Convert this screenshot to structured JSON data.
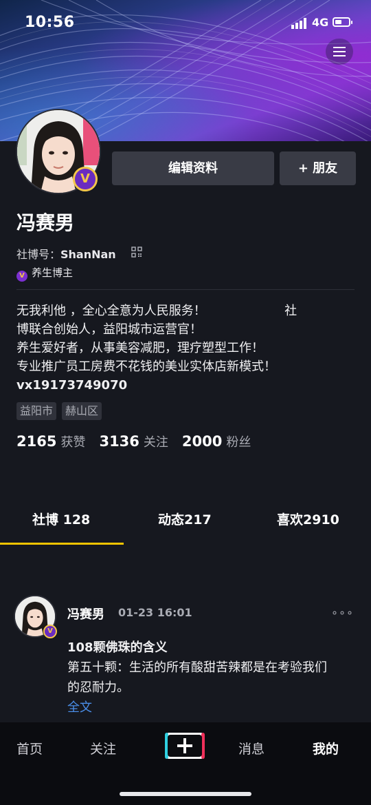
{
  "status_bar": {
    "time": "10:56",
    "network": "4G"
  },
  "profile": {
    "name": "冯赛男",
    "id_label": "社博号：",
    "id_value": "ShanNan",
    "verified_tag": "养生博主",
    "edit_button": "编辑资料",
    "add_friend_button": "+ 朋友"
  },
  "bio": {
    "lines": [
      "无我利他 ，全心全意为人民服务！                    社",
      "博联合创始人，益阳城市运营官！",
      "养生爱好者，从事美容减肥，理疗塑型工作！",
      "专业推广员工房费不花钱的美业实体店新模式！",
      "vx19173749070"
    ]
  },
  "locations": [
    "益阳市",
    "赫山区"
  ],
  "stats": [
    {
      "value": "2165",
      "label": "获赞"
    },
    {
      "value": "3136",
      "label": "关注"
    },
    {
      "value": "2000",
      "label": "粉丝"
    }
  ],
  "tabs": [
    {
      "label": "社博 128",
      "active": true
    },
    {
      "label": "动态217",
      "active": false
    },
    {
      "label": "喜欢2910",
      "active": false
    }
  ],
  "post": {
    "author": "冯赛男",
    "time": "01-23 16:01",
    "more": "∘∘∘",
    "lines": [
      "108颗佛珠的含义",
      "第五十颗：生活的所有酸甜苦辣都是在考验我们",
      "的忍耐力。"
    ],
    "full_text_link": "全文"
  },
  "bottom_nav": {
    "items": [
      {
        "label": "首页"
      },
      {
        "label": "关注"
      },
      {
        "label": "消息"
      },
      {
        "label": "我的",
        "active": true
      }
    ]
  },
  "colors": {
    "accent": "#f5c400",
    "link": "#4a8ee8",
    "badge": "#6a2cc0"
  }
}
